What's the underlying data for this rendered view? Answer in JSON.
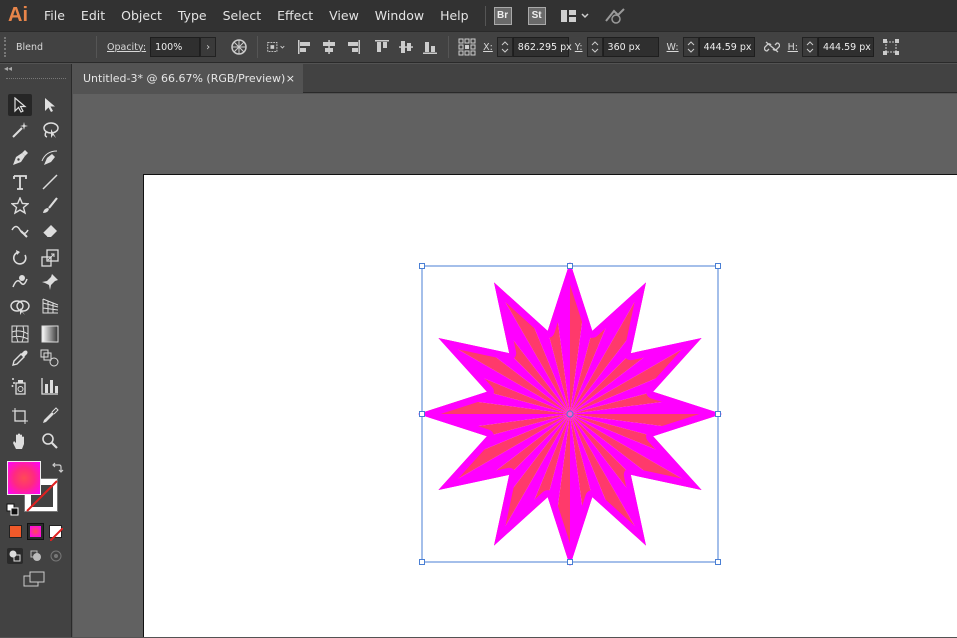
{
  "app": {
    "logo": "Ai"
  },
  "menu": [
    "File",
    "Edit",
    "Object",
    "Type",
    "Select",
    "Effect",
    "View",
    "Window",
    "Help"
  ],
  "menubar_icons": [
    "bridge-icon",
    "stock-icon",
    "workspace-switcher-icon",
    "gpu-performance-icon"
  ],
  "bridge_label": "Br",
  "stock_label": "St",
  "control": {
    "selection_type": "Blend",
    "opacity_label": "Opacity:",
    "opacity_value": "100%",
    "x_label": "X:",
    "x_value": "862.295 px",
    "y_label": "Y:",
    "y_value": "360 px",
    "w_label": "W:",
    "w_value": "444.59 px",
    "h_label": "H:",
    "h_value": "444.59 px"
  },
  "document": {
    "tab_title": "Untitled-3* @ 66.67% (RGB/Preview)",
    "close": "×"
  },
  "tools": [
    "selection-tool",
    "direct-selection-tool",
    "magic-wand-tool",
    "lasso-tool",
    "pen-tool",
    "curvature-tool",
    "type-tool",
    "line-segment-tool",
    "star-tool",
    "paintbrush-tool",
    "shaper-tool",
    "eraser-tool",
    "rotate-tool",
    "scale-tool",
    "warp-tool",
    "free-transform-tool",
    "shape-builder-tool",
    "perspective-grid-tool",
    "mesh-tool",
    "gradient-tool",
    "eyedropper-tool",
    "blend-tool",
    "symbol-sprayer-tool",
    "column-graph-tool",
    "artboard-tool",
    "slice-tool",
    "hand-tool",
    "zoom-tool"
  ],
  "colors": {
    "fill_center": "#ff3a6b",
    "fill_edge": "#ff00ff",
    "stroke": "none",
    "selection": "#4a7fd4",
    "logo": "#e8854a"
  }
}
